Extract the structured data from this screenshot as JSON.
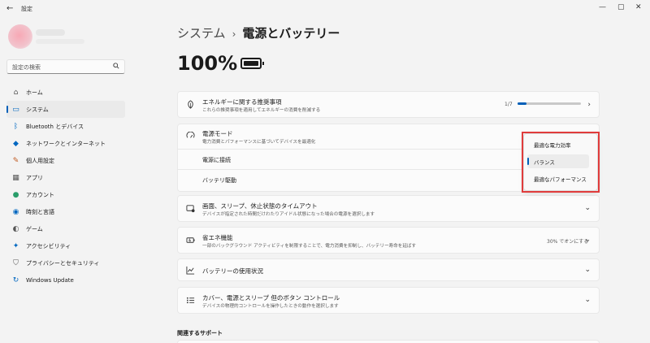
{
  "window": {
    "title": "設定",
    "back": "←",
    "min": "—",
    "max": "▢",
    "close": "✕"
  },
  "sidebar": {
    "search_placeholder": "設定の検索",
    "items": [
      {
        "label": "ホーム",
        "icon": "home-icon",
        "glyph": "⌂",
        "color": "#555555"
      },
      {
        "label": "システム",
        "icon": "system-icon",
        "glyph": "▭",
        "color": "#0067c0",
        "active": true
      },
      {
        "label": "Bluetooth とデバイス",
        "icon": "bluetooth-icon",
        "glyph": "ᛒ",
        "color": "#0067c0"
      },
      {
        "label": "ネットワークとインターネット",
        "icon": "wifi-icon",
        "glyph": "◆",
        "color": "#0067c0"
      },
      {
        "label": "個人用設定",
        "icon": "brush-icon",
        "glyph": "✎",
        "color": "#c05a20"
      },
      {
        "label": "アプリ",
        "icon": "apps-icon",
        "glyph": "▦",
        "color": "#555555"
      },
      {
        "label": "アカウント",
        "icon": "account-icon",
        "glyph": "●",
        "color": "#2a9d6a"
      },
      {
        "label": "時刻と言語",
        "icon": "globe-icon",
        "glyph": "◉",
        "color": "#0067c0"
      },
      {
        "label": "ゲーム",
        "icon": "game-icon",
        "glyph": "◐",
        "color": "#555555"
      },
      {
        "label": "アクセシビリティ",
        "icon": "accessibility-icon",
        "glyph": "✦",
        "color": "#0067c0"
      },
      {
        "label": "プライバシーとセキュリティ",
        "icon": "shield-icon",
        "glyph": "⛉",
        "color": "#555555"
      },
      {
        "label": "Windows Update",
        "icon": "update-icon",
        "glyph": "↻",
        "color": "#0067c0"
      }
    ]
  },
  "main": {
    "breadcrumb_parent": "システム",
    "breadcrumb_sep": "›",
    "breadcrumb_current": "電源とバッテリー",
    "battery_percent": "100%",
    "energy": {
      "title": "エネルギーに関する推奨事項",
      "desc": "これらの推奨事項を適用してエネルギーの消費を削減する",
      "progress_text": "1/7",
      "progress_fraction": 0.14
    },
    "power_mode": {
      "title": "電源モード",
      "desc": "電力消費とパフォーマンスに基づいてデバイスを最適化",
      "plugged_in": "電源に接続",
      "on_battery": "バッテリ駆動",
      "options": [
        "最適な電力効率",
        "バランス",
        "最適なパフォーマンス"
      ],
      "selected_index": 1
    },
    "screen_sleep": {
      "title": "画面、スリープ、休止状態のタイムアウト",
      "desc": "デバイスが指定された時間だけわたりアイドル状態になった場合の電源を選択します"
    },
    "energy_saver": {
      "title": "省エネ機能",
      "desc": "一部のバックグラウンド アクティビティを制限することで、電力消費を抑制し、バッテリー寿命を延ばす",
      "value": "30% でオンにする"
    },
    "battery_usage": {
      "title": "バッテリーの使用状況"
    },
    "lid_buttons": {
      "title": "カバー、電源とスリープ 但のボタン コントロール",
      "desc": "デバイスの物理的コントロールを操作したときの動作を選択します"
    },
    "related_support": "関連するサポート"
  },
  "colors": {
    "accent": "#005fb8",
    "highlight": "#e03c3c"
  }
}
